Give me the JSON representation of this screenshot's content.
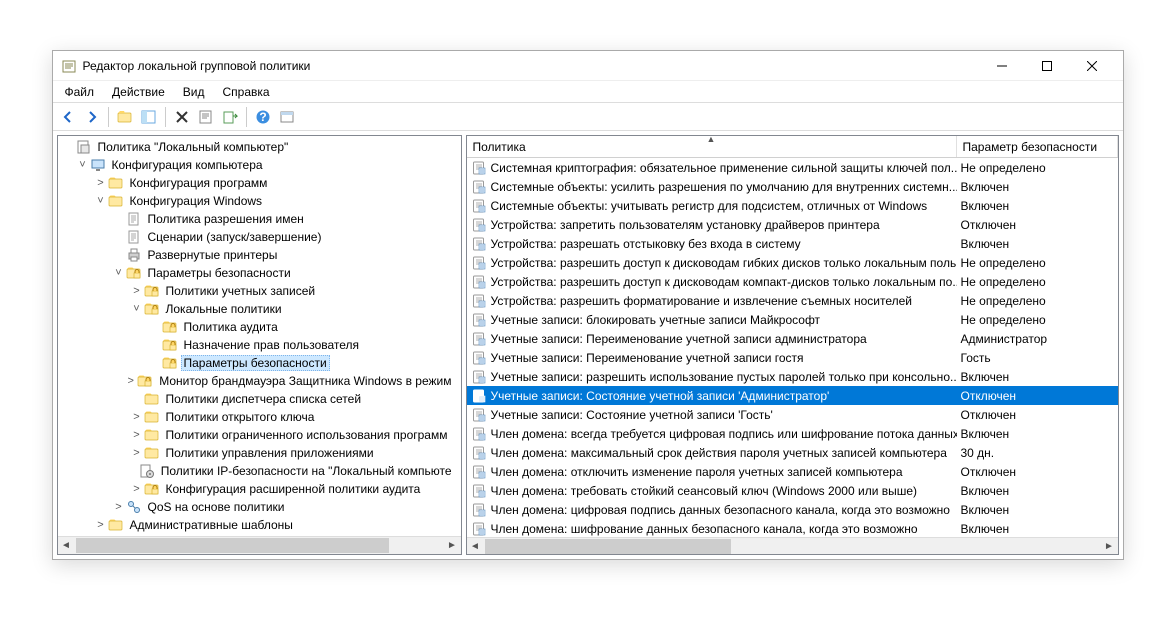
{
  "window": {
    "title": "Редактор локальной групповой политики"
  },
  "menu": {
    "file": "Файл",
    "action": "Действие",
    "view": "Вид",
    "help": "Справка"
  },
  "tree": {
    "root": "Политика \"Локальный компьютер\"",
    "cc": "Конфигурация компьютера",
    "cp": "Конфигурация программ",
    "cw": "Конфигурация Windows",
    "pnr": "Политика разрешения имен",
    "scr": "Сценарии (запуск/завершение)",
    "dp": "Развернутые принтеры",
    "sec": "Параметры безопасности",
    "accpol": "Политики учетных записей",
    "locpol": "Локальные политики",
    "audit": "Политика аудита",
    "ura": "Назначение прав пользователя",
    "secopt": "Параметры безопасности",
    "fw": "Монитор брандмауэра Защитника Windows в режим",
    "nlm": "Политики диспетчера списка сетей",
    "pk": "Политики открытого ключа",
    "srp": "Политики ограниченного использования программ",
    "acp": "Политики управления приложениями",
    "ipsec": "Политики IP-безопасности на \"Локальный компьюте",
    "aap": "Конфигурация расширенной политики аудита",
    "qos": "QoS на основе политики",
    "adm": "Административные шаблоны"
  },
  "list": {
    "header_policy": "Политика",
    "header_param": "Параметр безопасности",
    "rows": [
      {
        "p": "Системная криптография: обязательное применение сильной защиты ключей пол...",
        "v": "Не определено"
      },
      {
        "p": "Системные объекты: усилить разрешения по умолчанию для внутренних системн...",
        "v": "Включен"
      },
      {
        "p": "Системные объекты: учитывать регистр для подсистем, отличных от Windows",
        "v": "Включен"
      },
      {
        "p": "Устройства: запретить пользователям установку драйверов принтера",
        "v": "Отключен"
      },
      {
        "p": "Устройства: разрешать отстыковку без входа в систему",
        "v": "Включен"
      },
      {
        "p": "Устройства: разрешить доступ к дисководам гибких дисков только локальным поль...",
        "v": "Не определено"
      },
      {
        "p": "Устройства: разрешить доступ к дисководам компакт-дисков только локальным по...",
        "v": "Не определено"
      },
      {
        "p": "Устройства: разрешить форматирование и извлечение съемных носителей",
        "v": "Не определено"
      },
      {
        "p": "Учетные записи: блокировать учетные записи Майкрософт",
        "v": "Не определено"
      },
      {
        "p": "Учетные записи: Переименование учетной записи администратора",
        "v": "Администратор"
      },
      {
        "p": "Учетные записи: Переименование учетной записи гостя",
        "v": "Гость"
      },
      {
        "p": "Учетные записи: разрешить использование пустых паролей только при консольно...",
        "v": "Включен"
      },
      {
        "p": "Учетные записи: Состояние учетной записи 'Администратор'",
        "v": "Отключен",
        "sel": true
      },
      {
        "p": "Учетные записи: Состояние учетной записи 'Гость'",
        "v": "Отключен"
      },
      {
        "p": "Член домена: всегда требуется цифровая подпись или шифрование потока данных ...",
        "v": "Включен"
      },
      {
        "p": "Член домена: максимальный срок действия пароля учетных записей компьютера",
        "v": "30 дн."
      },
      {
        "p": "Член домена: отключить изменение пароля учетных записей компьютера",
        "v": "Отключен"
      },
      {
        "p": "Член домена: требовать стойкий сеансовый ключ (Windows 2000 или выше)",
        "v": "Включен"
      },
      {
        "p": "Член домена: цифровая подпись данных безопасного канала, когда это возможно",
        "v": "Включен"
      },
      {
        "p": "Член домена: шифрование данных безопасного канала, когда это возможно",
        "v": "Включен"
      }
    ]
  }
}
